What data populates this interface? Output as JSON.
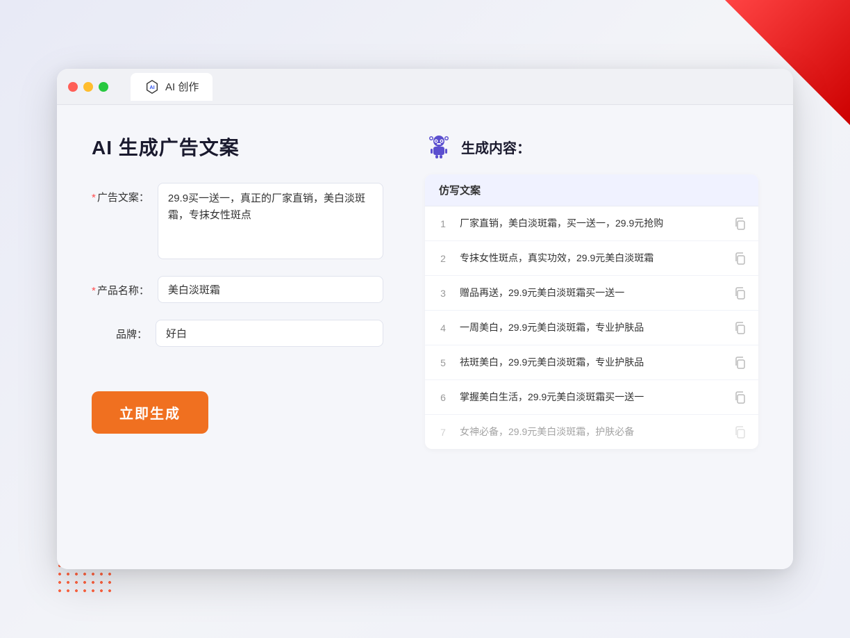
{
  "browser": {
    "tab_title": "AI 创作"
  },
  "left_panel": {
    "page_title": "AI 生成广告文案",
    "form": {
      "ad_copy_label": "广告文案：",
      "ad_copy_required": "*",
      "ad_copy_value": "29.9买一送一，真正的厂家直销，美白淡斑霜，专抹女性斑点",
      "product_name_label": "产品名称：",
      "product_name_required": "*",
      "product_name_value": "美白淡斑霜",
      "brand_label": "品牌：",
      "brand_value": "好白",
      "generate_button": "立即生成"
    }
  },
  "right_panel": {
    "title": "生成内容：",
    "table_header": "仿写文案",
    "results": [
      {
        "id": 1,
        "text": "厂家直销，美白淡斑霜，买一送一，29.9元抢购",
        "faded": false
      },
      {
        "id": 2,
        "text": "专抹女性斑点，真实功效，29.9元美白淡斑霜",
        "faded": false
      },
      {
        "id": 3,
        "text": "赠品再送，29.9元美白淡斑霜买一送一",
        "faded": false
      },
      {
        "id": 4,
        "text": "一周美白，29.9元美白淡斑霜，专业护肤品",
        "faded": false
      },
      {
        "id": 5,
        "text": "祛斑美白，29.9元美白淡斑霜，专业护肤品",
        "faded": false
      },
      {
        "id": 6,
        "text": "掌握美白生活，29.9元美白淡斑霜买一送一",
        "faded": false
      },
      {
        "id": 7,
        "text": "女神必备，29.9元美白淡斑霜，护肤必备",
        "faded": true
      }
    ]
  }
}
